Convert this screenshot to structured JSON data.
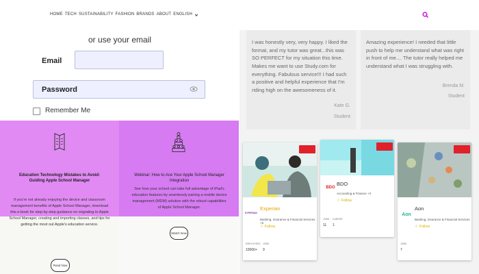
{
  "nav": {
    "items": [
      "HOME",
      "TECH",
      "SUSTAINABILITY",
      "FASHION",
      "BRANDS",
      "ABOUT",
      "ENGLISH"
    ]
  },
  "login": {
    "or_email": "or use your email",
    "email_label": "Email",
    "email_value": "",
    "password_label": "Password",
    "remember_label": "Remember Me"
  },
  "cards": [
    {
      "title": "Education Technology Mistakes to Avoid: Guiding Apple School Manager",
      "body": "If you're not already enjoying the device and classroom management benefits of Apple School Manager, download this e-book for step-by-step guidance on migrating to Apple School Manager, creating and importing classes, and tips for getting the most out Apple's education service.",
      "button": "Read Now"
    },
    {
      "title": "Webinar: How to Ace Your Apple School Manager Integration",
      "body": "See how your school can take full advantage of iPad's education features by seamlessly pairing a mobile device management (MDM) solution with the robust capabilities of Apple School Manager.",
      "button": "Watch Now"
    }
  ],
  "testimonials": [
    {
      "quote": "I was honestly very, very happy. I liked the format, and my tutor was great...this was SO PERFECT for my situation this time. Makes me want to use Study.com for everything. Fabulous service!!! I had such a positive and helpful experience that I'm riding high on the awesomeness of it.",
      "name": "Kate G.",
      "role": "Student"
    },
    {
      "quote": "Amazing experience! I needed that little push to help me understand what was right in front of me.... The tutor really helped me understand what I was struggling with.",
      "name": "Brenda M.",
      "role": "Student"
    }
  ],
  "jobs": [
    {
      "logo": "EXPERIAN",
      "name": "Experian",
      "sub": "Banking, Insurance & Financial Services +5",
      "follow": "Follow",
      "stats": [
        {
          "label": "EMPLOYEES",
          "value": "10000+"
        },
        {
          "label": "JOBS",
          "value": "9"
        }
      ]
    },
    {
      "logo": "BDO",
      "name": "BDO",
      "sub": "Accounting & Finance +3",
      "follow": "Follow",
      "stats": [
        {
          "label": "JOBS",
          "value": "11"
        },
        {
          "label": "CAREER",
          "value": "1"
        }
      ]
    },
    {
      "logo": "Aon",
      "name": "Aon",
      "sub": "Banking, Insurance & Financial Services",
      "follow": "Follow",
      "stats": [
        {
          "label": "JOBS",
          "value": "7"
        }
      ]
    }
  ],
  "colors": {
    "card1": "#e18af4",
    "card2": "#d67bf2",
    "search_icon": "#c21fd6",
    "follow": "#d5b400",
    "badge": "#e0202a"
  },
  "icons": [
    "chevron-down-icon",
    "search-icon",
    "eye-icon",
    "book-icon",
    "people-pyramid-icon"
  ]
}
